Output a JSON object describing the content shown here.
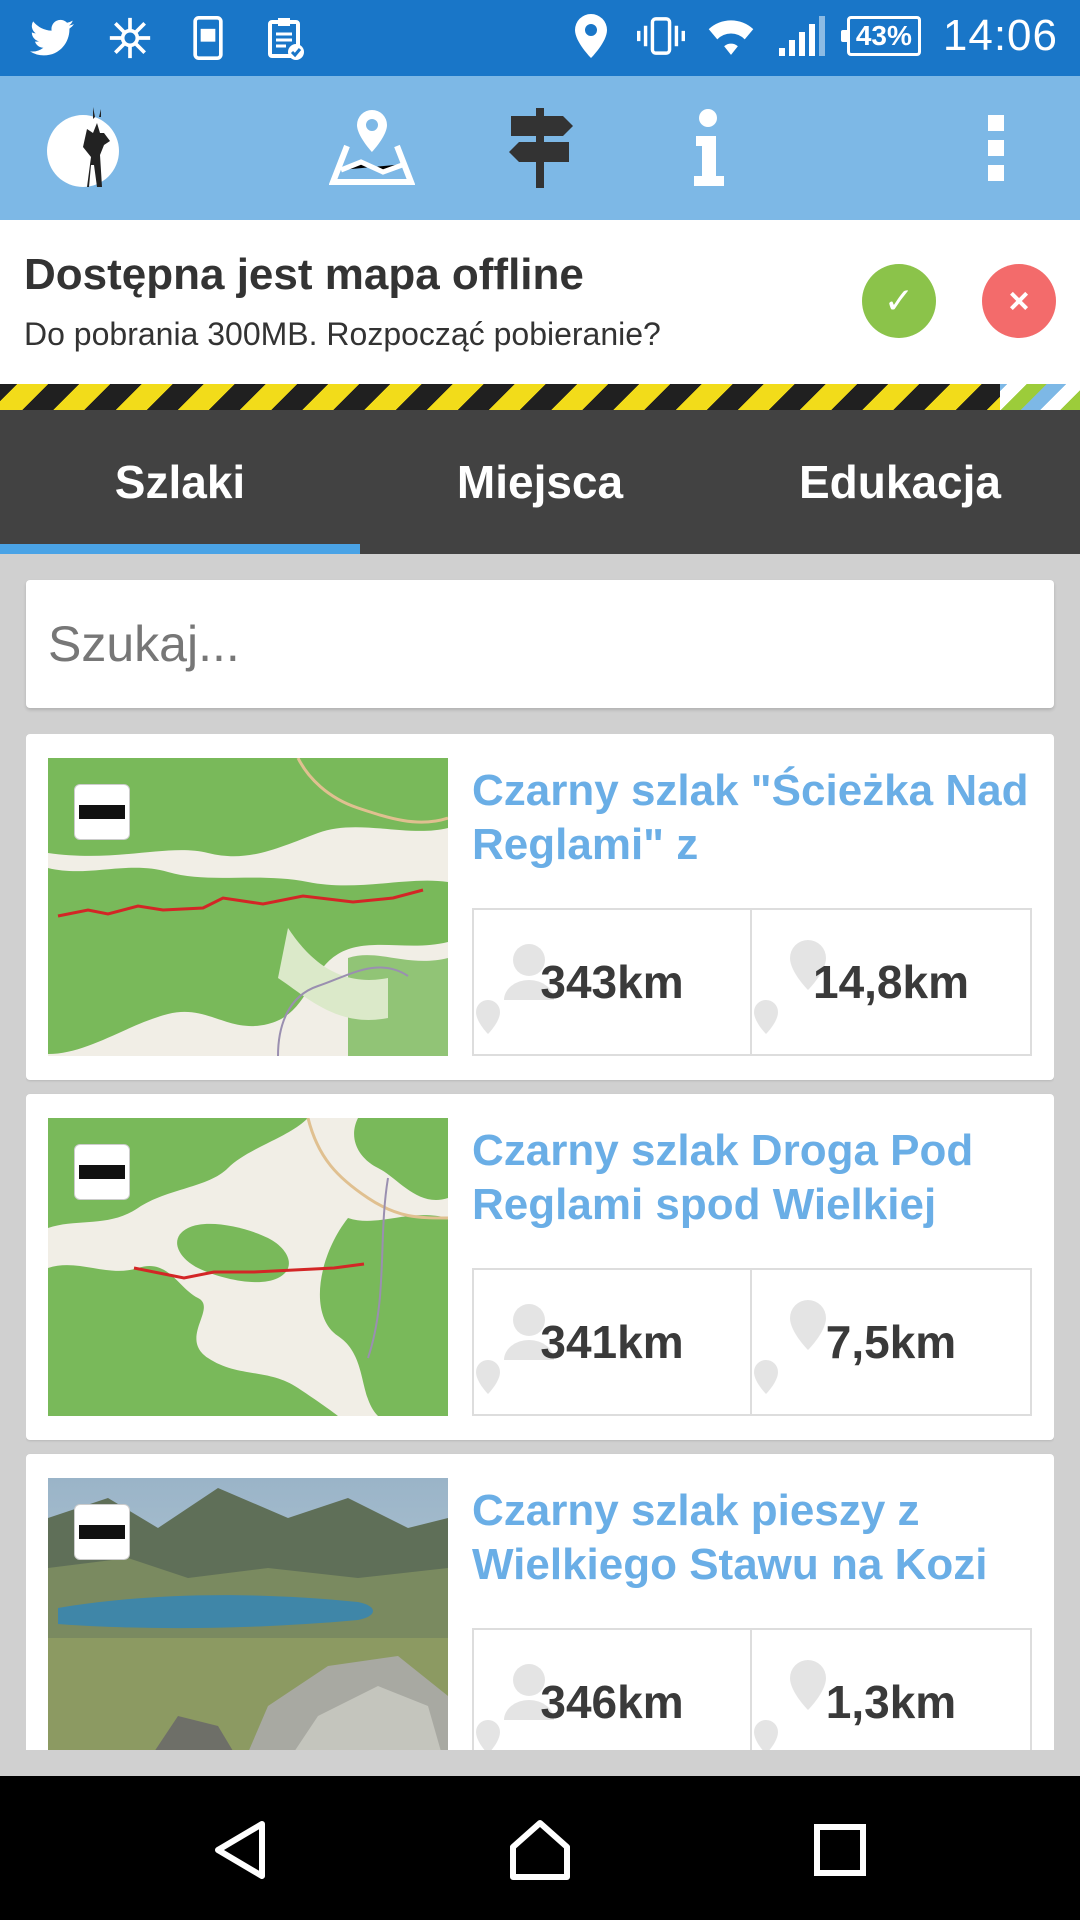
{
  "status_bar": {
    "battery": "43%",
    "time": "14:06"
  },
  "banner": {
    "title": "Dostępna jest mapa offline",
    "subtitle": "Do pobrania 300MB. Rozpocząć pobieranie?",
    "accept_symbol": "✓",
    "decline_symbol": "×"
  },
  "tabs": [
    {
      "label": "Szlaki",
      "active": true
    },
    {
      "label": "Miejsca",
      "active": false
    },
    {
      "label": "Edukacja",
      "active": false
    }
  ],
  "search": {
    "placeholder": "Szukaj..."
  },
  "trails": [
    {
      "title": "Czarny szlak \"Ścieżka Nad Reglami\" z",
      "distance_from_user": "343km",
      "length": "14,8km",
      "thumbnail": "map"
    },
    {
      "title": "Czarny szlak Droga Pod Reglami spod Wielkiej",
      "distance_from_user": "341km",
      "length": "7,5km",
      "thumbnail": "map"
    },
    {
      "title": "Czarny szlak pieszy  z Wielkiego Stawu na Kozi",
      "distance_from_user": "346km",
      "length": "1,3km",
      "thumbnail": "photo"
    }
  ],
  "colors": {
    "status_bar": "#1976c8",
    "app_bar": "#7db8e6",
    "tab_bar": "#424242",
    "tab_indicator": "#4aa3e6",
    "trail_title": "#6aaee6",
    "accept": "#8bc34a",
    "decline": "#f36b6b"
  }
}
